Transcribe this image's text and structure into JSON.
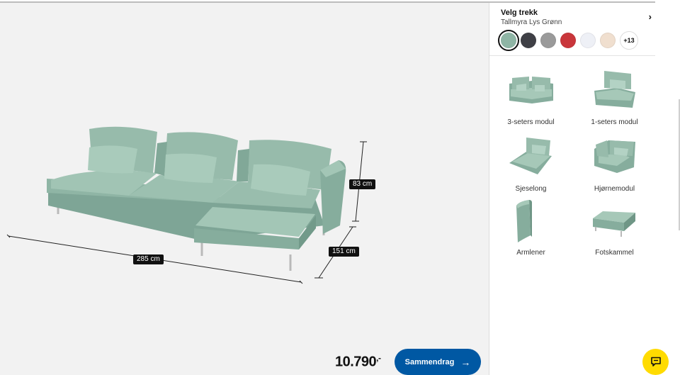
{
  "cover": {
    "title": "Velg trekk",
    "value": "Tallmyra Lys Grønn",
    "chevron_icon": "chevron-right-icon"
  },
  "swatches": [
    {
      "name": "light-green",
      "color": "#8fb5a5",
      "selected": true
    },
    {
      "name": "dark-grey",
      "color": "#3f4046"
    },
    {
      "name": "grey",
      "color": "#9a9a9a"
    },
    {
      "name": "red",
      "color": "#c9363b"
    },
    {
      "name": "white",
      "color": "#eef0f6"
    },
    {
      "name": "beige",
      "color": "#f0dfcf"
    }
  ],
  "more_swatches_label": "+13",
  "modules": [
    {
      "label": "3-seters modul",
      "icon": "three-seat-module-icon"
    },
    {
      "label": "1-seters modul",
      "icon": "one-seat-module-icon"
    },
    {
      "label": "Sjeselong",
      "icon": "chaise-longue-icon"
    },
    {
      "label": "Hjørnemodul",
      "icon": "corner-module-icon"
    },
    {
      "label": "Armlener",
      "icon": "armrest-icon"
    },
    {
      "label": "Fotskammel",
      "icon": "footstool-icon"
    }
  ],
  "dimensions": {
    "width": "285 cm",
    "height": "83 cm",
    "depth": "151 cm"
  },
  "price": {
    "amount": "10.790",
    "suffix": ",-"
  },
  "summary_button": {
    "label": "Sammendrag",
    "icon": "arrow-right-icon"
  },
  "chat_button": {
    "icon": "chat-icon"
  },
  "colors": {
    "accent": "#0058a3",
    "chat": "#ffdb00",
    "sofa": "#8fb5a5"
  }
}
